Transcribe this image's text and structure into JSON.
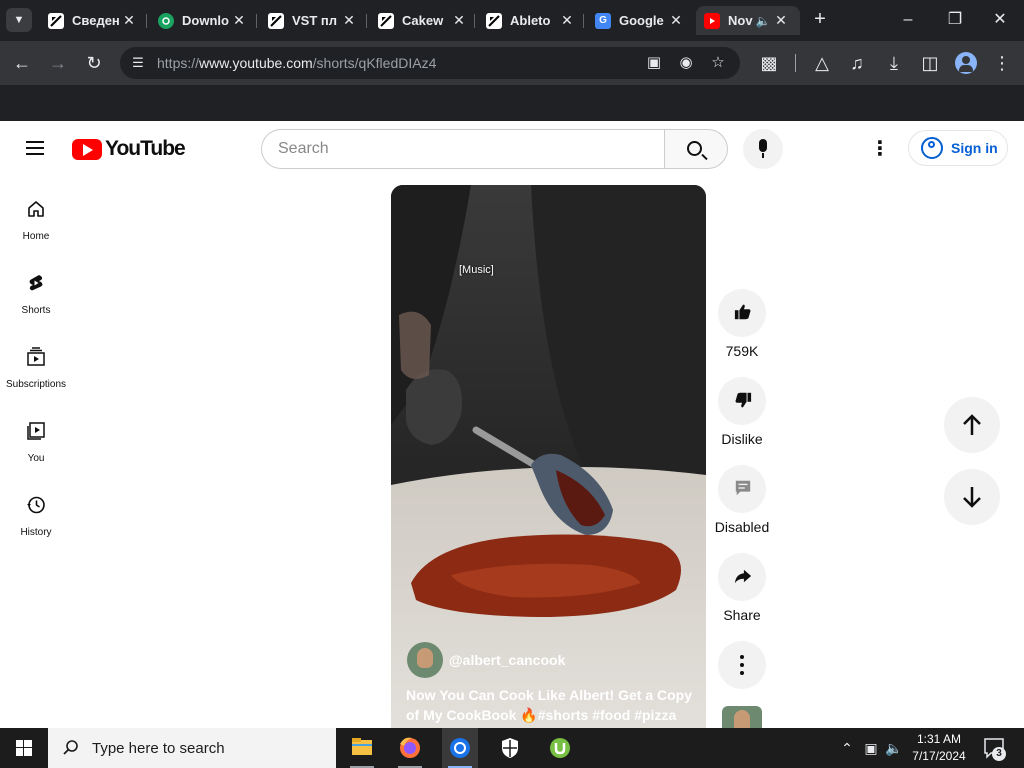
{
  "browser": {
    "tabs": [
      {
        "title": "Сведен",
        "favicon": "document-icon"
      },
      {
        "title": "Downlo",
        "favicon": "download-site-icon"
      },
      {
        "title": "VST пл",
        "favicon": "document-icon"
      },
      {
        "title": "Cakew",
        "favicon": "document-icon"
      },
      {
        "title": "Ableto",
        "favicon": "document-icon"
      },
      {
        "title": "Google",
        "favicon": "google-translate-icon"
      },
      {
        "title": "Nov",
        "favicon": "youtube-icon",
        "active": true
      }
    ],
    "address": {
      "scheme": "https://",
      "domain": "www.youtube.com",
      "path": "/shorts/qKfledDIAz4"
    },
    "colors": {
      "frame": "#202124",
      "toolbar": "#35363a",
      "text": "#e8eaed"
    }
  },
  "youtube": {
    "logo_text": "YouTube",
    "search": {
      "placeholder": "Search"
    },
    "sign_in_label": "Sign in",
    "guide": [
      {
        "label": "Home",
        "icon": "home-icon"
      },
      {
        "label": "Shorts",
        "icon": "shorts-icon"
      },
      {
        "label": "Subscriptions",
        "icon": "subscriptions-icon"
      },
      {
        "label": "You",
        "icon": "you-icon"
      },
      {
        "label": "History",
        "icon": "history-icon"
      }
    ],
    "short": {
      "caption": "[Music]",
      "channel": "@albert_cancook",
      "title": "Now You Can Cook Like Albert! Get a Copy of My CookBook 🔥#shorts #food #pizza"
    },
    "actions": {
      "like": "759K",
      "dislike": "Dislike",
      "comments": "Disabled",
      "share": "Share"
    },
    "colors": {
      "brand_red": "#ff0000",
      "link_blue": "#065fd4"
    }
  },
  "taskbar": {
    "search_placeholder": "Type here to search",
    "time": "1:31 AM",
    "date": "7/17/2024",
    "notification_count": "3"
  }
}
